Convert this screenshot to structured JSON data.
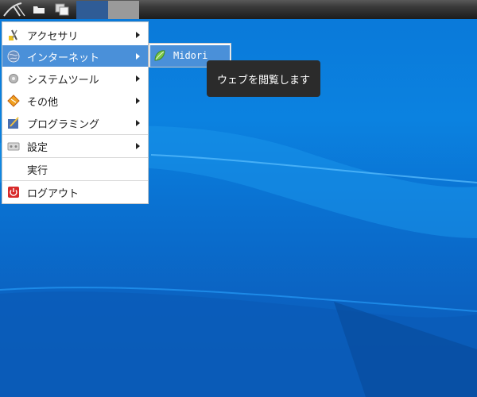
{
  "panel": {
    "icons": [
      "app-menu-icon",
      "file-manager-icon",
      "show-desktop-icon"
    ],
    "workspaces": [
      "workspace-1",
      "workspace-2"
    ]
  },
  "main_menu": {
    "items": [
      {
        "label": "アクセサリ",
        "icon": "accessories-icon",
        "submenu": true
      },
      {
        "label": "インターネット",
        "icon": "internet-globe-icon",
        "submenu": true,
        "active": true
      },
      {
        "label": "システムツール",
        "icon": "system-tools-gear-icon",
        "submenu": true
      },
      {
        "label": "その他",
        "icon": "other-diamond-icon",
        "submenu": true
      },
      {
        "label": "プログラミング",
        "icon": "programming-icon",
        "submenu": true
      },
      {
        "label": "設定",
        "icon": "settings-icon",
        "submenu": true
      },
      {
        "label": "実行",
        "icon": "",
        "submenu": false
      },
      {
        "label": "ログアウト",
        "icon": "logout-power-icon",
        "submenu": false
      }
    ]
  },
  "sub_menu": {
    "items": [
      {
        "label": "Midori",
        "icon": "midori-browser-icon"
      }
    ]
  },
  "tooltip": {
    "text": "ウェブを閲覧します"
  },
  "colors": {
    "highlight": "#4a90d9",
    "panel": "#1c1c1c",
    "desktop": "#0a78d8",
    "tooltip_bg": "#2b2b2b"
  }
}
